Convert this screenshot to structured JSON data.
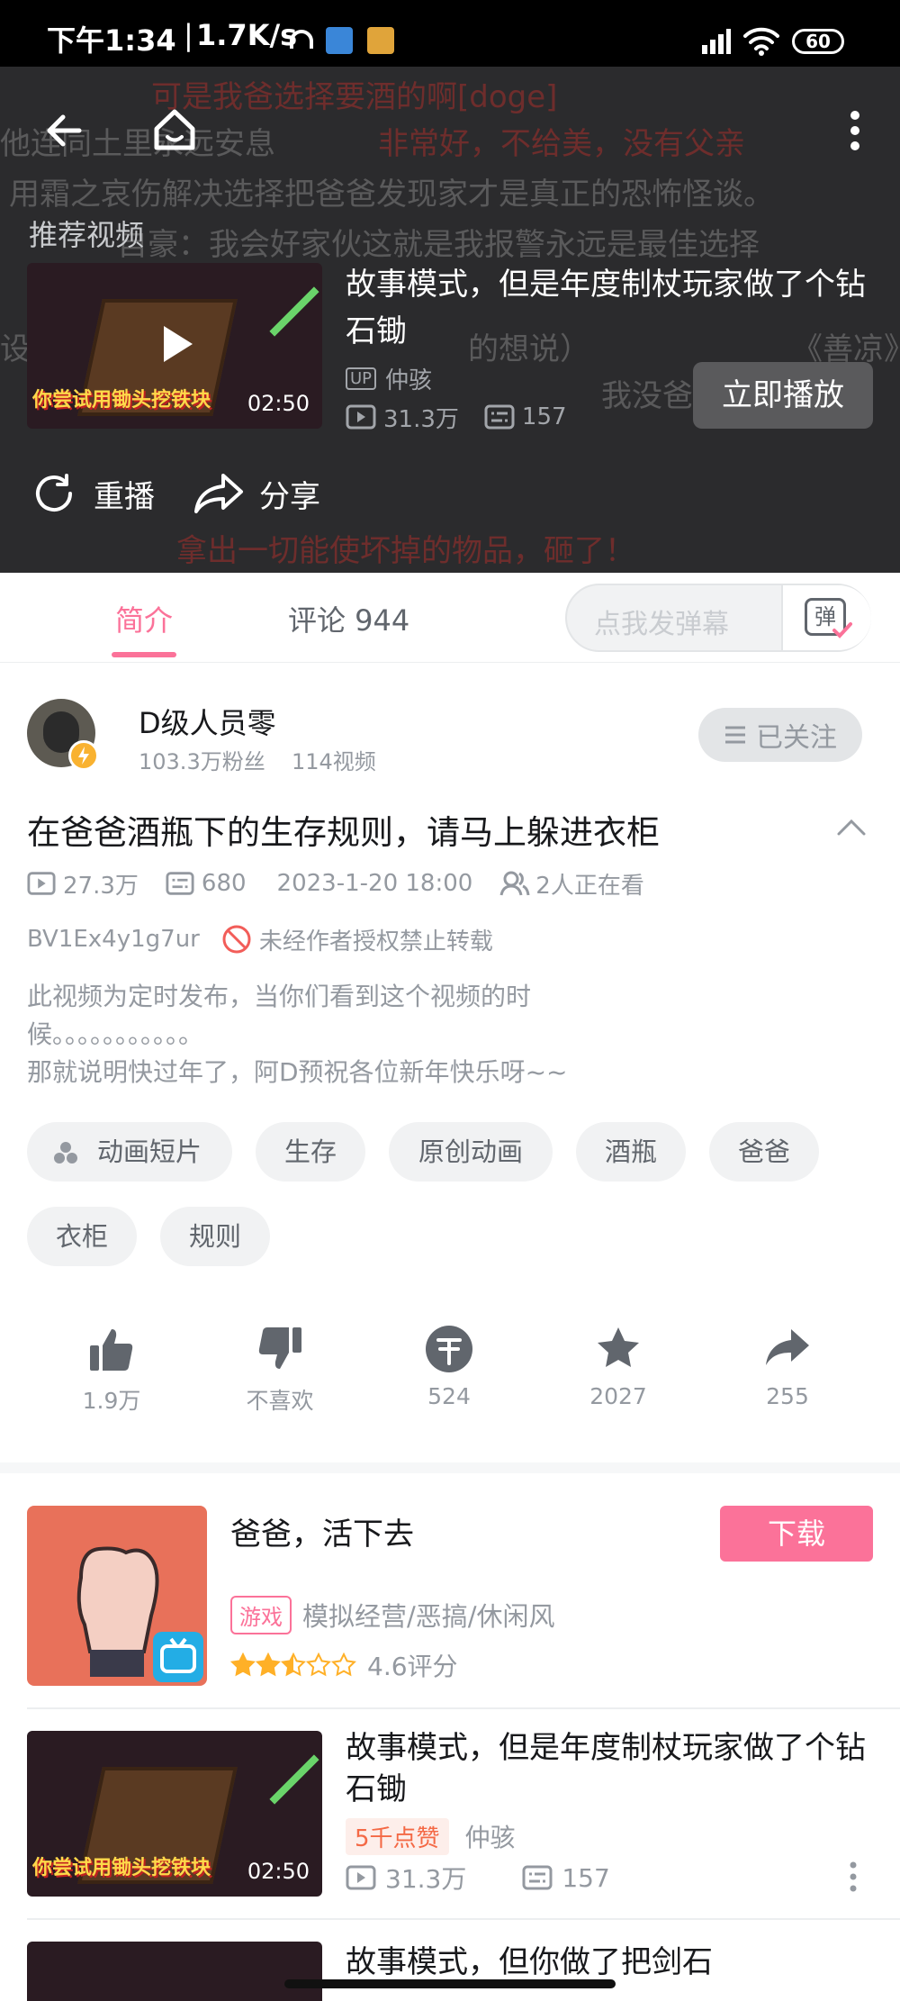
{
  "status_bar": {
    "time": "下午1:34",
    "speed": "1.7K/s",
    "battery": "60"
  },
  "player": {
    "danmaku": [
      "可是我爸选择要酒的啊[doge]",
      "他连同土里永远安息",
      "非常好，不给美，没有父亲",
      "用霜之哀伤解决选择把爸爸发现家才是真正的恐怖怪谈。",
      "自豪：我会好家伙这就是我报警永远是最佳选择",
      "设",
      "的想说）",
      "《善凉》",
      "我没爸",
      "拿出一切能使坏掉的物品，砸了！"
    ],
    "recommend_label": "推荐视频",
    "recommend": {
      "title": "故事模式，但是年度制杖玩家做了个钻石锄",
      "up_badge": "UP",
      "author": "仲骇",
      "views": "31.3万",
      "danmaku_count": "157",
      "duration": "02:50",
      "thumb_caption": "你尝试用锄头挖铁块",
      "play_now": "立即播放"
    },
    "replay": "重播",
    "share": "分享"
  },
  "tabs": {
    "intro": "简介",
    "comments": "评论 944",
    "danmaku_placeholder": "点我发弹幕",
    "danmaku_icon_text": "弹"
  },
  "uploader": {
    "name": "D级人员零",
    "fans": "103.3万粉丝",
    "videos": "114视频",
    "follow": "已关注"
  },
  "video": {
    "title": "在爸爸酒瓶下的生存规则，请马上躲进衣柜",
    "views": "27.3万",
    "danmaku": "680",
    "date": "2023-1-20 18:00",
    "watching": "2人正在看",
    "bvid": "BV1Ex4y1g7ur",
    "copyright": "未经作者授权禁止转载",
    "desc1": "此视频为定时发布，当你们看到这个视频的时",
    "desc2": "候。。。。。。。。。。。",
    "desc3": "那就说明快过年了，阿D预祝各位新年快乐呀~~",
    "tags": [
      "动画短片",
      "生存",
      "原创动画",
      "酒瓶",
      "爸爸",
      "衣柜",
      "规则"
    ]
  },
  "actions": {
    "like": "1.9万",
    "dislike": "不喜欢",
    "coin": "524",
    "fav": "2027",
    "share": "255"
  },
  "ad": {
    "title": "爸爸，活下去",
    "category": "游戏",
    "genres": "模拟经营/恶搞/休闲风",
    "rating": "4.6评分",
    "rating_value": 2.5,
    "download": "下载"
  },
  "related": [
    {
      "title": "故事模式，但是年度制杖玩家做了个钻石锄",
      "badge": "5千点赞",
      "author": "仲骇",
      "views": "31.3万",
      "danmaku": "157",
      "duration": "02:50",
      "thumb_caption": "你尝试用锄头挖铁块"
    },
    {
      "title": "故事模式，但你做了把剑石"
    }
  ],
  "colors": {
    "accent": "#fb7299",
    "text": "#18191c",
    "sub": "#9499a0"
  }
}
